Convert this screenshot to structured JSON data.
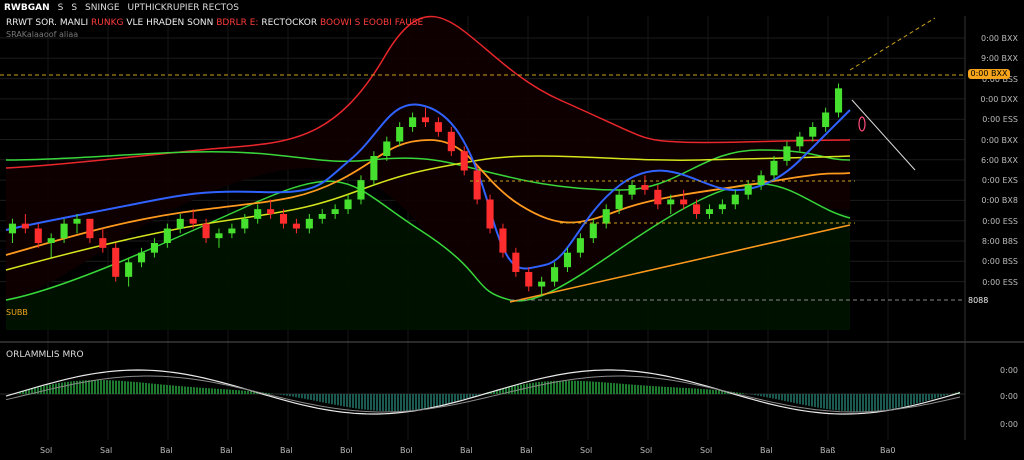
{
  "toolbar": {
    "items": [
      "RWBGAN",
      "S",
      "S",
      "SNINGE",
      "UPTHICKRUPIER RECTOS"
    ]
  },
  "title": {
    "white": "RRWT SOR. MANLI ",
    "red1": "RUNKG ",
    "white2": "VLE HRADEN SONN ",
    "red2": "BDRLR E: ",
    "white3": "RECTOCKOR ",
    "red3": "BOOWI S EOOBI FAUSE"
  },
  "subtitle": "SRAKalaaoof aliaa",
  "price_axis": [
    "0:00 BXX",
    "9:00 BXX",
    "0:00 BSS",
    "0:00 DXX",
    "0:00 ESS",
    "0:00 BXX",
    "6:00 BXX",
    "0:00 EXS",
    "0:00 BX8",
    "0:00 ESS",
    "8:00 B8S",
    "0:00 BSS",
    "0:00 ESS"
  ],
  "current_price": "0:00 BXX",
  "left_tag": "SUBB",
  "right_tag": "8088",
  "subpanel": {
    "title": "ORLAMMLIS MRO",
    "axis": [
      "0:00",
      "0:00",
      "0:00"
    ]
  },
  "time_axis": [
    "Sol",
    "Sal",
    "Bal",
    "Bal",
    "Bal",
    "Bol",
    "Bol",
    "Bal",
    "Bal",
    "Sol",
    "Sol",
    "Sol",
    "Bal",
    "Baß",
    "Ba0"
  ],
  "colors": {
    "bull": "#46e02f",
    "bear": "#ff2d2d",
    "upper_band": "#e8262b",
    "lower_band": "#38d63b",
    "fast_ma": "#2f62ff",
    "mid_ma": "#ff9a1f",
    "slow_ma": "#d6e51c",
    "osc_line": "#eaeaea"
  },
  "chart_data": {
    "type": "candlestick",
    "ohlc": [
      [
        60,
        63,
        58,
        62
      ],
      [
        62,
        64,
        60,
        61
      ],
      [
        61,
        62,
        57,
        58
      ],
      [
        58,
        60,
        55,
        59
      ],
      [
        59,
        63,
        58,
        62
      ],
      [
        62,
        64,
        60,
        63
      ],
      [
        63,
        63,
        58,
        59
      ],
      [
        59,
        61,
        56,
        57
      ],
      [
        57,
        58,
        50,
        51
      ],
      [
        51,
        55,
        49,
        54
      ],
      [
        54,
        57,
        53,
        56
      ],
      [
        56,
        59,
        55,
        58
      ],
      [
        58,
        62,
        57,
        61
      ],
      [
        61,
        64,
        60,
        63
      ],
      [
        63,
        65,
        61,
        62
      ],
      [
        62,
        63,
        58,
        59
      ],
      [
        59,
        61,
        57,
        60
      ],
      [
        60,
        62,
        59,
        61
      ],
      [
        61,
        64,
        60,
        63
      ],
      [
        63,
        66,
        62,
        65
      ],
      [
        65,
        67,
        63,
        64
      ],
      [
        64,
        65,
        61,
        62
      ],
      [
        62,
        63,
        60,
        61
      ],
      [
        61,
        64,
        60,
        63
      ],
      [
        63,
        65,
        62,
        64
      ],
      [
        64,
        66,
        63,
        65
      ],
      [
        65,
        68,
        64,
        67
      ],
      [
        67,
        72,
        66,
        71
      ],
      [
        71,
        77,
        70,
        76
      ],
      [
        76,
        80,
        75,
        79
      ],
      [
        79,
        83,
        78,
        82
      ],
      [
        82,
        85,
        81,
        84
      ],
      [
        84,
        86,
        82,
        83
      ],
      [
        83,
        84,
        80,
        81
      ],
      [
        81,
        82,
        76,
        77
      ],
      [
        77,
        78,
        72,
        73
      ],
      [
        73,
        74,
        66,
        67
      ],
      [
        67,
        68,
        60,
        61
      ],
      [
        61,
        62,
        55,
        56
      ],
      [
        56,
        57,
        51,
        52
      ],
      [
        52,
        53,
        48,
        49
      ],
      [
        49,
        51,
        47,
        50
      ],
      [
        50,
        54,
        49,
        53
      ],
      [
        53,
        57,
        52,
        56
      ],
      [
        56,
        60,
        55,
        59
      ],
      [
        59,
        63,
        58,
        62
      ],
      [
        62,
        66,
        61,
        65
      ],
      [
        65,
        69,
        64,
        68
      ],
      [
        68,
        71,
        67,
        70
      ],
      [
        70,
        72,
        68,
        69
      ],
      [
        69,
        70,
        65,
        66
      ],
      [
        66,
        68,
        64,
        67
      ],
      [
        67,
        69,
        65,
        66
      ],
      [
        66,
        67,
        63,
        64
      ],
      [
        64,
        66,
        63,
        65
      ],
      [
        65,
        67,
        64,
        66
      ],
      [
        66,
        69,
        65,
        68
      ],
      [
        68,
        71,
        67,
        70
      ],
      [
        70,
        73,
        69,
        72
      ],
      [
        72,
        76,
        71,
        75
      ],
      [
        75,
        79,
        74,
        78
      ],
      [
        78,
        81,
        77,
        80
      ],
      [
        80,
        83,
        79,
        82
      ],
      [
        82,
        86,
        81,
        85
      ],
      [
        85,
        91,
        84,
        90
      ]
    ],
    "ylim": [
      40,
      100
    ]
  }
}
